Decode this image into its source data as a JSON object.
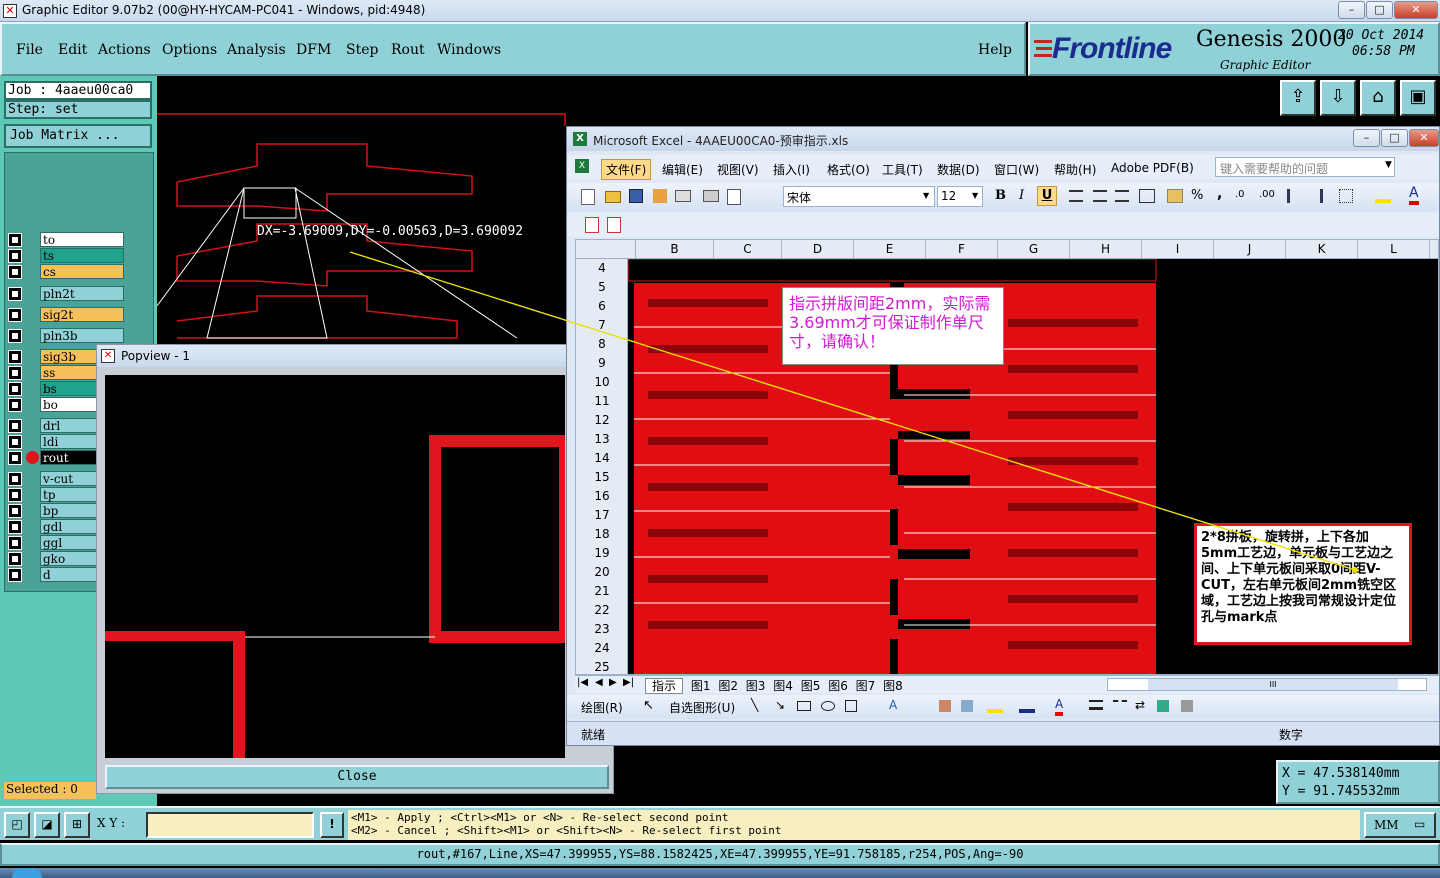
{
  "titlebar": {
    "title": "Graphic Editor 9.07b2 (00@HY-HYCAM-PC041 - Windows, pid:4948)"
  },
  "menu": {
    "items": [
      "File",
      "Edit",
      "Actions",
      "Options",
      "Analysis",
      "DFM",
      "Step",
      "Rout",
      "Windows"
    ],
    "help": "Help"
  },
  "brand": {
    "logo": "Frontline",
    "product": "Genesis 2000",
    "subtitle": "Graphic Editor",
    "date": "20 Oct 2014",
    "time": "06:58 PM"
  },
  "job": {
    "job_label": "Job : 4aaeu00ca0",
    "step_label": "Step: set",
    "matrix_button": "Job Matrix ..."
  },
  "layers": [
    {
      "name": "to",
      "color": "#ffffff"
    },
    {
      "name": "ts",
      "color": "#1fa38f"
    },
    {
      "name": "cs",
      "color": "#f7c15a"
    },
    {
      "name": "pln2t",
      "color": "#8fd1d6"
    },
    {
      "name": "sig2t",
      "color": "#f7c15a"
    },
    {
      "name": "pln3b",
      "color": "#8fd1d6"
    },
    {
      "name": "sig3b",
      "color": "#f7c15a"
    },
    {
      "name": "ss",
      "color": "#f7c15a"
    },
    {
      "name": "bs",
      "color": "#1fa38f"
    },
    {
      "name": "bo",
      "color": "#ffffff"
    },
    {
      "name": "drl",
      "color": "#8fd1d6"
    },
    {
      "name": "ldi",
      "color": "#8fd1d6"
    },
    {
      "name": "rout",
      "color": "#000000",
      "active": true
    },
    {
      "name": "v-cut",
      "color": "#8fd1d6"
    },
    {
      "name": "tp",
      "color": "#8fd1d6"
    },
    {
      "name": "bp",
      "color": "#8fd1d6"
    },
    {
      "name": "gdl",
      "color": "#8fd1d6"
    },
    {
      "name": "ggl",
      "color": "#8fd1d6"
    },
    {
      "name": "gko",
      "color": "#8fd1d6"
    },
    {
      "name": "d",
      "color": "#8fd1d6"
    }
  ],
  "measure": {
    "text": "DX=-3.69009,DY=-0.00563,D=3.690092"
  },
  "selected": {
    "label": "Selected : 0"
  },
  "popview": {
    "title": "Popview - 1",
    "close": "Close"
  },
  "excel": {
    "title": "Microsoft Excel - 4AAEU00CA0-预审指示.xls",
    "menus": [
      "文件(F)",
      "编辑(E)",
      "视图(V)",
      "插入(I)",
      "格式(O)",
      "工具(T)",
      "数据(D)",
      "窗口(W)",
      "帮助(H)",
      "Adobe PDF(B)"
    ],
    "help_placeholder": "键入需要帮助的问题",
    "font_name": "宋体",
    "font_size": "12",
    "format_buttons": {
      "bold": "B",
      "italic": "I",
      "underline": "U",
      "percent": "%",
      "comma": ","
    },
    "columns": [
      "B",
      "C",
      "D",
      "E",
      "F",
      "G",
      "H",
      "I",
      "J",
      "K",
      "L"
    ],
    "rows": [
      "4",
      "5",
      "6",
      "7",
      "8",
      "9",
      "10",
      "11",
      "12",
      "13",
      "14",
      "15",
      "16",
      "17",
      "18",
      "19",
      "20",
      "21",
      "22",
      "23",
      "24",
      "25"
    ],
    "note1": "指示拼版间距2mm，实际需3.69mm才可保证制作单尺寸，请确认！",
    "note2": "2*8拼板，旋转拼，上下各加5mm工艺边，单元板与工艺边之间、上下单元板间采取0间距V-CUT，左右单元板间2mm铣空区域，工艺边上按我司常规设计定位孔与mark点",
    "sheet_tabs": [
      "指示",
      "图1",
      "图2",
      "图3",
      "图4",
      "图5",
      "图6",
      "图7",
      "图8"
    ],
    "drawing_toolbar": {
      "draw": "绘图(R)",
      "autoshape": "自选图形(U)"
    },
    "status_ready": "就绪",
    "status_num": "数字",
    "hscroll": "III"
  },
  "coords": {
    "x": "X  =  47.538140mm",
    "y": "Y  =  91.745532mm"
  },
  "command": {
    "xy_label": "X Y :",
    "xy_value": "",
    "hint1": "<M1> - Apply  ; <Ctrl><M1> or <N> - Re-select second point",
    "hint2": "<M2> - Cancel ; <Shift><M1> or <Shift><N> - Re-select first point",
    "units": "MM",
    "warn": "!"
  },
  "status": {
    "text": "rout,#167,Line,XS=47.399955,YS=88.1582425,XE=47.399955,YE=91.758185,r254,POS,Ang=-90"
  }
}
